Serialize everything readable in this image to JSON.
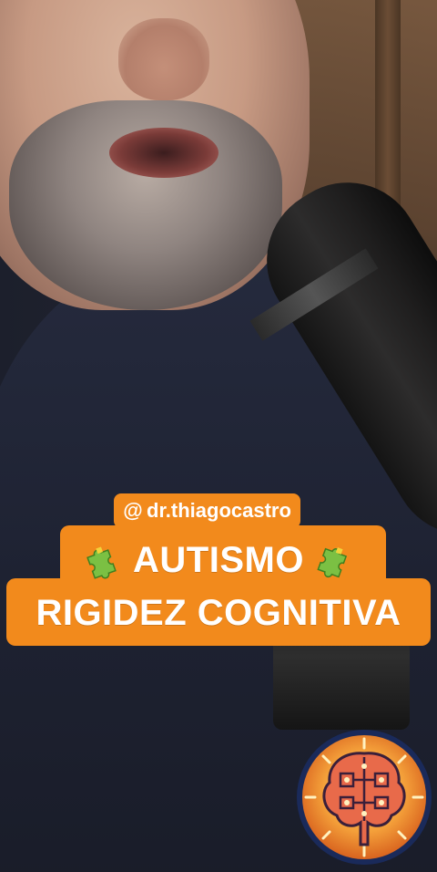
{
  "overlay": {
    "handle": "dr.thiagocastro",
    "title_line1": "AUTISMO",
    "title_line2": "RIGIDEZ COGNITIVA"
  },
  "icons": {
    "handle_icon": "threads-icon",
    "left_icon": "puzzle-piece-icon",
    "right_icon": "puzzle-piece-icon",
    "logo": "brain-logo"
  },
  "colors": {
    "accent_orange": "#f28a1c",
    "text_white": "#ffffff"
  }
}
